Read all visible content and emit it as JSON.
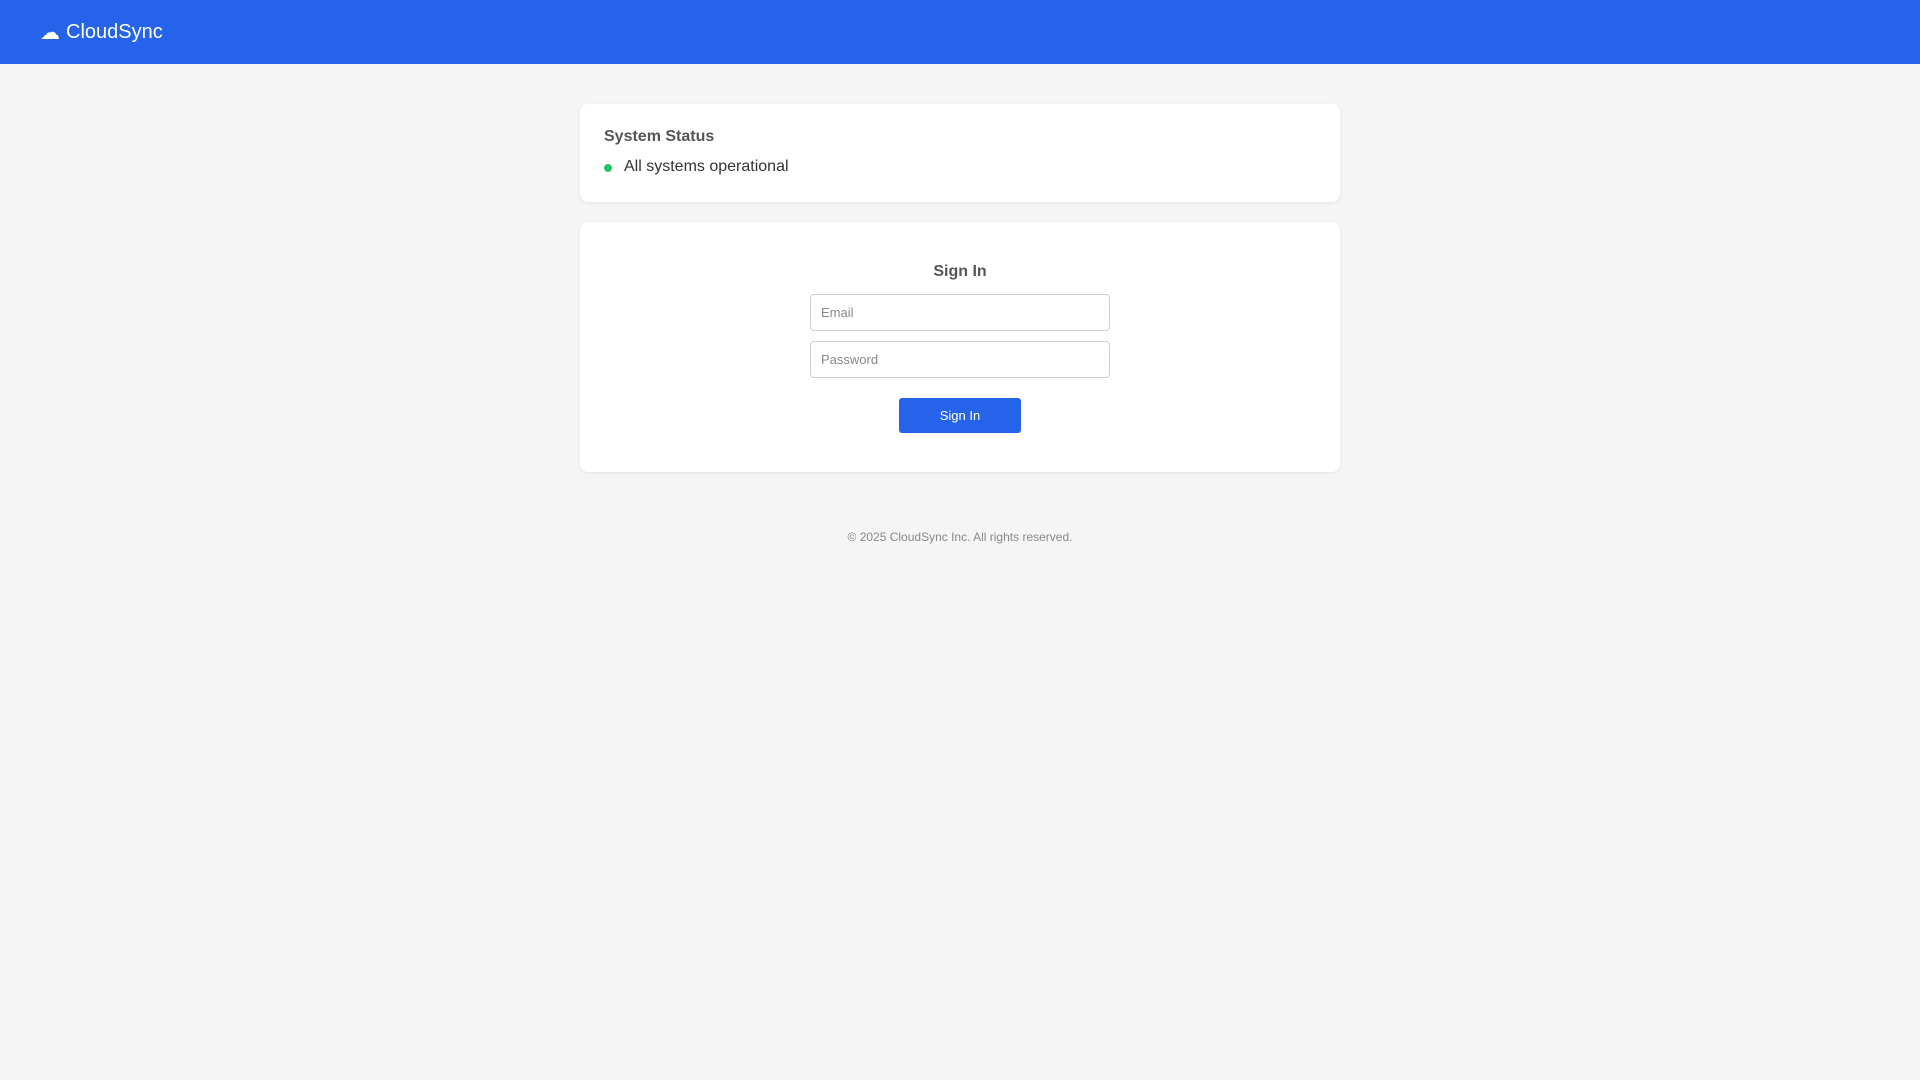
{
  "header": {
    "brand_icon": "☁",
    "brand_name": "CloudSync",
    "background_color": "#2563eb"
  },
  "status": {
    "title": "System Status",
    "indicator_color": "#22c55e",
    "message": "All systems operational"
  },
  "signin": {
    "title": "Sign In",
    "email_placeholder": "Email",
    "email_value": "",
    "password_placeholder": "Password",
    "password_value": "",
    "button_label": "Sign In",
    "button_color": "#2563eb"
  },
  "footer": {
    "text": "© 2025 CloudSync Inc. All rights reserved."
  }
}
